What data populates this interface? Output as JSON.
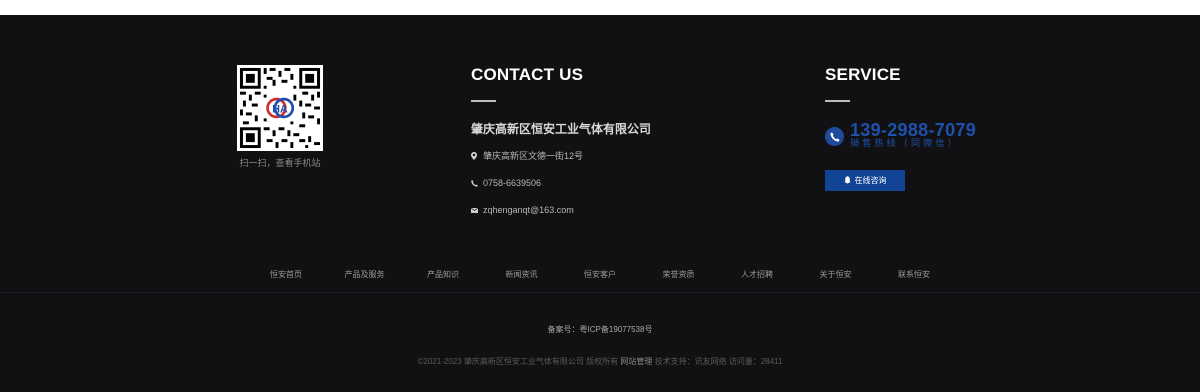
{
  "qr": {
    "caption": "扫一扫，查看手机站"
  },
  "contact": {
    "title": "CONTACT US",
    "company": "肇庆高新区恒安工业气体有限公司",
    "address": "肇庆高新区文德一街12号",
    "phone": "0758-6639506",
    "email": "zqhenganqt@163.com"
  },
  "service": {
    "title": "SERVICE",
    "hotline_number": "139-2988-7079",
    "hotline_label": "销售热线（同微信）",
    "consult_label": "在线咨询"
  },
  "nav": [
    "恒安首页",
    "产品及服务",
    "产品知识",
    "新闻资讯",
    "恒安客户",
    "荣誉资质",
    "人才招聘",
    "关于恒安",
    "联系恒安"
  ],
  "footer": {
    "icp": "备案号：粤ICP备19077538号",
    "copyright_prefix": "©2021-2023 肇庆高新区恒安工业气体有限公司 版权所有",
    "admin_link": "网站管理",
    "copyright_suffix": "技术支持：讯友网络 访问量：28411"
  },
  "colors": {
    "background": "#111113",
    "accent_blue": "#1e51ad",
    "button_blue": "#114494"
  },
  "icons": [
    "qr-code",
    "location-pin-icon",
    "phone-icon",
    "mail-icon",
    "phone-circle-icon",
    "qq-icon"
  ]
}
